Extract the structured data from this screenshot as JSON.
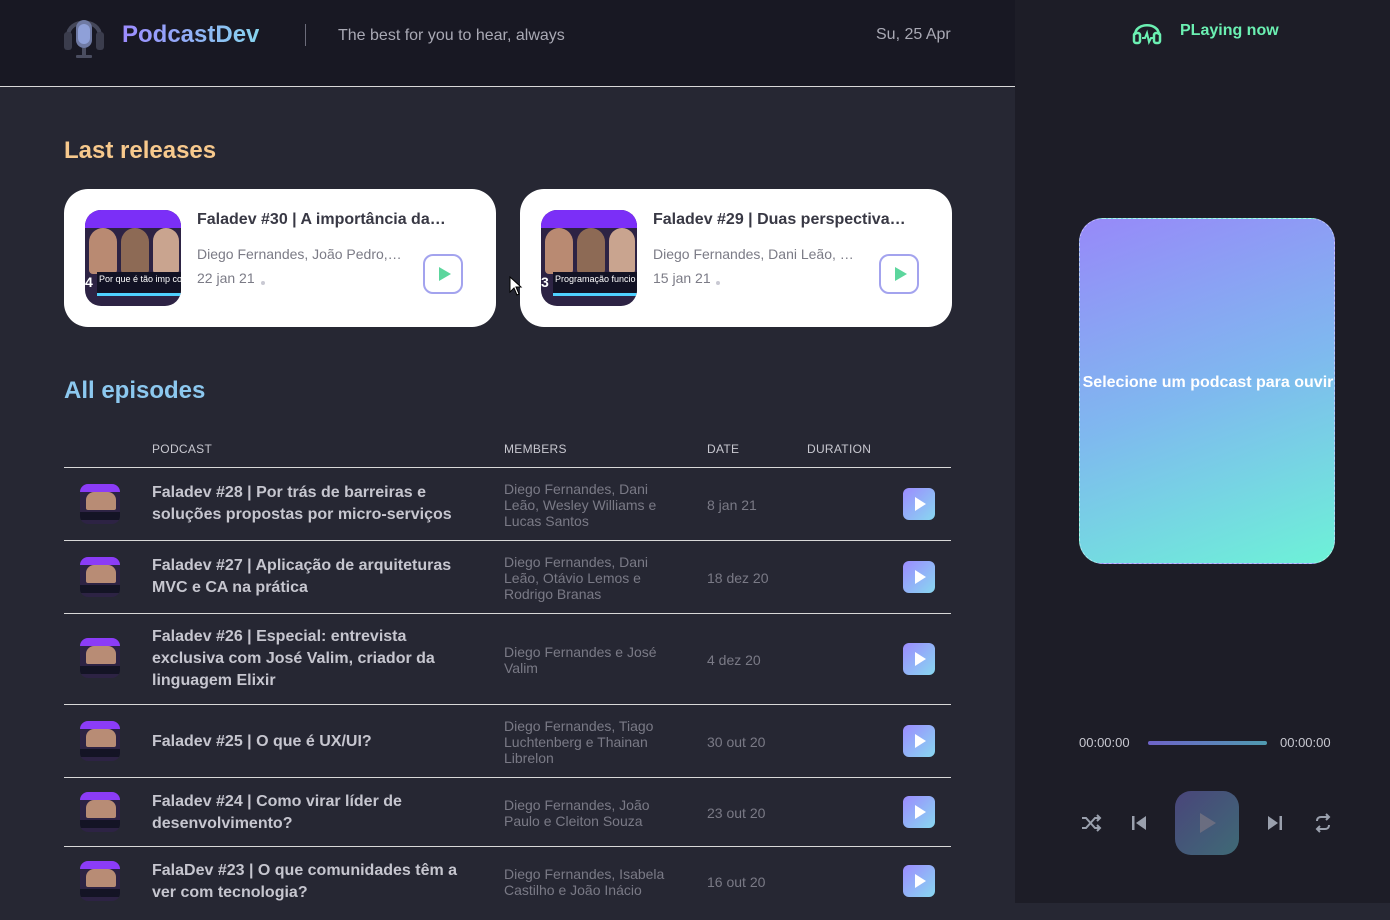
{
  "header": {
    "brand": "PodcastDev",
    "tagline": "The best for you to hear, always",
    "date": "Su, 25 Apr"
  },
  "latest": {
    "title": "Last releases",
    "cards": [
      {
        "title": "Faladev #30 | A importância da…",
        "members": "Diego Fernandes, João Pedro,…",
        "date": "22 jan 21",
        "thumb_number": "4",
        "thumb_text": "Por que é tão imp contribuir em Open S"
      },
      {
        "title": "Faladev #29 | Duas perspectiva…",
        "members": "Diego Fernandes, Dani Leão, …",
        "date": "15 jan 21",
        "thumb_number": "3",
        "thumb_text": "Programação funcio devs orientados a o"
      }
    ]
  },
  "all": {
    "title": "All episodes",
    "columns": [
      "PODCAST",
      "MEMBERS",
      "DATE",
      "DURATION"
    ],
    "rows": [
      {
        "title": "Faladev #28 | Por trás de barreiras e soluções propostas por micro-serviços",
        "members": "Diego Fernandes, Dani Leão, Wesley Williams e Lucas Santos",
        "date": "8 jan 21",
        "duration": ""
      },
      {
        "title": "Faladev #27 | Aplicação de arquiteturas MVC e CA na prática",
        "members": "Diego Fernandes, Dani Leão, Otávio Lemos e Rodrigo Branas",
        "date": "18 dez 20",
        "duration": ""
      },
      {
        "title": "Faladev #26 | Especial: entrevista exclusiva com José Valim, criador da linguagem Elixir",
        "members": "Diego Fernandes e José Valim",
        "date": "4 dez 20",
        "duration": ""
      },
      {
        "title": "Faladev #25 | O que é UX/UI?",
        "members": "Diego Fernandes, Tiago Luchtenberg e Thainan Librelon",
        "date": "30 out 20",
        "duration": ""
      },
      {
        "title": "Faladev #24 | Como virar líder de desenvolvimento?",
        "members": "Diego Fernandes, João Paulo e Cleiton Souza",
        "date": "23 out 20",
        "duration": ""
      },
      {
        "title": "FalaDev #23 | O que comunidades têm a ver com tecnologia?",
        "members": "Diego Fernandes, Isabela Castilho e João Inácio",
        "date": "16 out 20",
        "duration": ""
      }
    ]
  },
  "player": {
    "label": "PLaying now",
    "empty_message": "Selecione um podcast para ouvir",
    "current_time": "00:00:00",
    "total_time": "00:00:00",
    "progress_fraction": 0
  },
  "colors": {
    "accent_green": "#6bf0b2",
    "accent_purple": "#9c8bff",
    "accent_cyan": "#86d4ee",
    "section_orange": "#f7c98d"
  },
  "icons": [
    "microphone-logo-icon",
    "headphones-icon",
    "play-icon",
    "shuffle-icon",
    "previous-icon",
    "next-icon",
    "repeat-icon"
  ]
}
